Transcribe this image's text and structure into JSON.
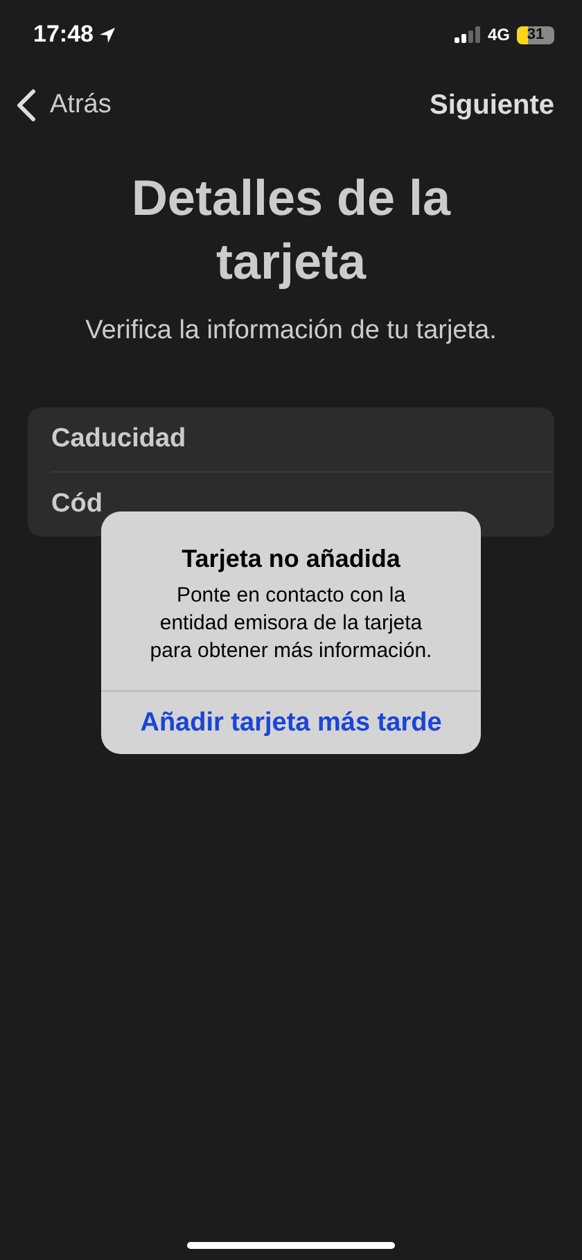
{
  "status_bar": {
    "time": "17:48",
    "network": "4G",
    "battery": "31"
  },
  "nav": {
    "back": "Atrás",
    "next": "Siguiente"
  },
  "title": "Detalles de la tarjeta",
  "subtitle": "Verifica la información de tu tarjeta.",
  "form_rows": [
    "Caducidad",
    "Cód"
  ],
  "alert": {
    "title": "Tarjeta no añadida",
    "message": "Ponte en contacto con la entidad emisora de la tarjeta para obtener más información.",
    "buttons": [
      "Añadir tarjeta más tarde"
    ]
  }
}
